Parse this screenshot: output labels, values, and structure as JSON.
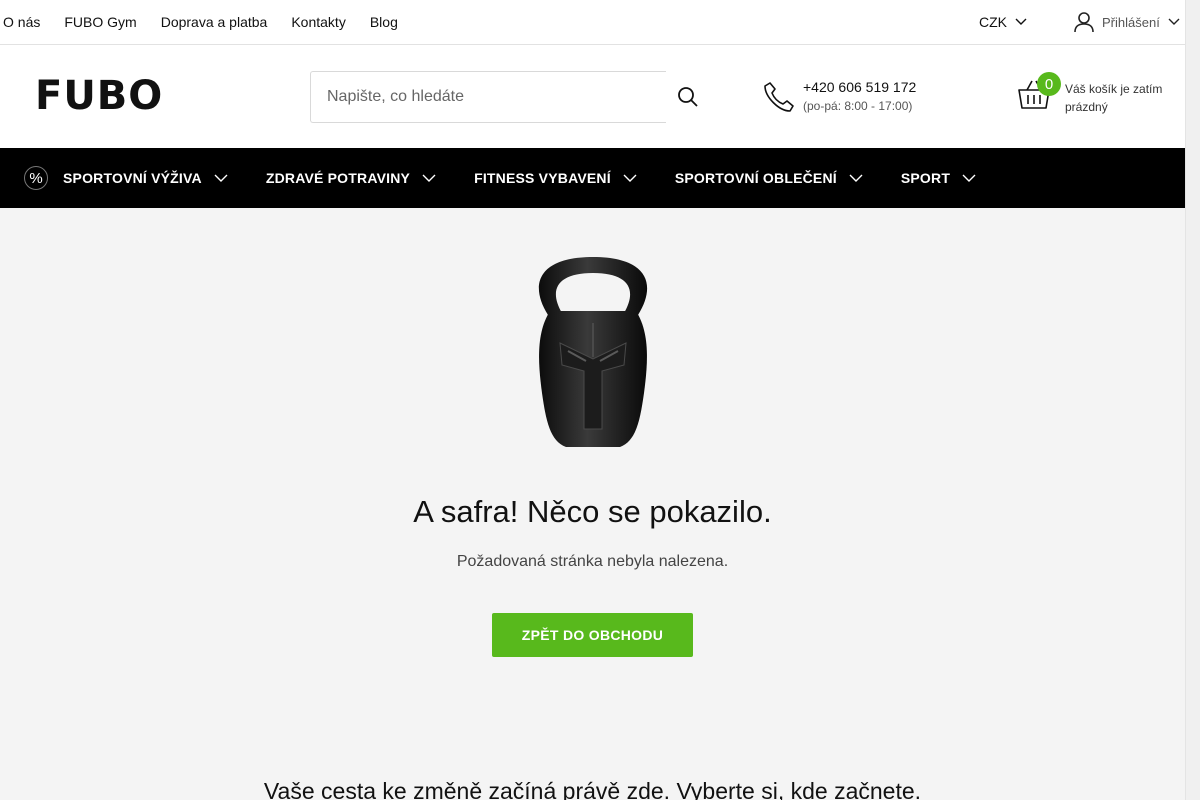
{
  "topbar": {
    "links": [
      "O nás",
      "FUBO Gym",
      "Doprava a platba",
      "Kontakty",
      "Blog"
    ],
    "currency": "CZK",
    "login_label": "Přihlášení"
  },
  "header": {
    "logo_text": "FUBO",
    "search_placeholder": "Napište, co hledáte",
    "phone_number": "+420 606 519 172",
    "phone_hours": "(po-pá: 8:00 - 17:00)",
    "cart_count": "0",
    "cart_text": "Váš košík je zatím prázdný"
  },
  "nav": {
    "promo_symbol": "%",
    "items": [
      "SPORTOVNÍ VÝŽIVA",
      "ZDRAVÉ POTRAVINY",
      "FITNESS VYBAVENÍ",
      "SPORTOVNÍ OBLEČENÍ",
      "SPORT"
    ]
  },
  "main": {
    "title": "A safra! Něco se pokazilo.",
    "subtitle": "Požadovaná stránka nebyla nalezena.",
    "cta_label": "ZPĚT DO OBCHODU",
    "bottom_heading": "Vaše cesta ke změně začíná právě zde. Vyberte si, kde začnete."
  },
  "colors": {
    "accent_green": "#58b91c",
    "nav_background": "#000000",
    "page_background": "#f4f4f4"
  },
  "icons": {
    "search": "search-icon",
    "phone": "phone-icon",
    "cart": "basket-icon",
    "user": "user-icon",
    "chevron": "chevron-down-icon",
    "promo": "percent-icon"
  }
}
